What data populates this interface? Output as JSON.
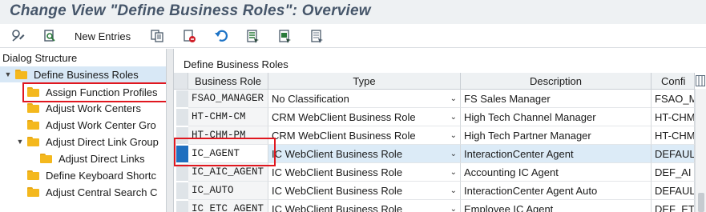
{
  "title": "Change View \"Define Business Roles\": Overview",
  "toolbar": {
    "new_entries_label": "New Entries",
    "icons": [
      "display-change-icon",
      "other-view-icon",
      "copy-icon",
      "delete-icon",
      "undo-icon",
      "select-all-icon",
      "select-block-icon",
      "deselect-all-icon"
    ]
  },
  "left_panel": {
    "header": "Dialog Structure",
    "items": [
      {
        "label": "Define Business Roles",
        "expanded": true,
        "selected": true
      },
      {
        "label": "Assign Function Profiles"
      },
      {
        "label": "Adjust Work Centers"
      },
      {
        "label": "Adjust Work Center Gro"
      },
      {
        "label": "Adjust Direct Link Group",
        "expanded": true
      },
      {
        "label": "Adjust Direct Links"
      },
      {
        "label": "Define Keyboard Shortc"
      },
      {
        "label": "Adjust Central Search C"
      }
    ]
  },
  "table": {
    "caption": "Define Business Roles",
    "columns": [
      "Business Role",
      "Type",
      "Description",
      "Confi"
    ],
    "rows": [
      {
        "role": "FSAO_MANAGER",
        "type": "No Classification",
        "desc": "FS Sales Manager",
        "config": "FSAO_M"
      },
      {
        "role": "HT-CHM-CM",
        "type": "CRM WebClient Business Role",
        "desc": "High Tech Channel Manager",
        "config": "HT-CHM"
      },
      {
        "role": "HT-CHM-PM",
        "type": "CRM WebClient Business Role",
        "desc": "High Tech Partner Manager",
        "config": "HT-CHM"
      },
      {
        "role": "IC_AGENT",
        "type": "IC WebClient Business Role",
        "desc": "InteractionCenter Agent",
        "config": "DEFAUL",
        "active": true
      },
      {
        "role": "IC_AIC_AGENT",
        "type": "IC WebClient Business Role",
        "desc": "Accounting IC Agent",
        "config": "DEF_AI"
      },
      {
        "role": "IC_AUTO",
        "type": "IC WebClient Business Role",
        "desc": "InteractionCenter Agent Auto",
        "config": "DEFAUL"
      },
      {
        "role": "IC_ETC_AGENT",
        "type": "IC WebClient Business Role",
        "desc": "Employee IC Agent",
        "config": "DEF_ET"
      }
    ]
  }
}
